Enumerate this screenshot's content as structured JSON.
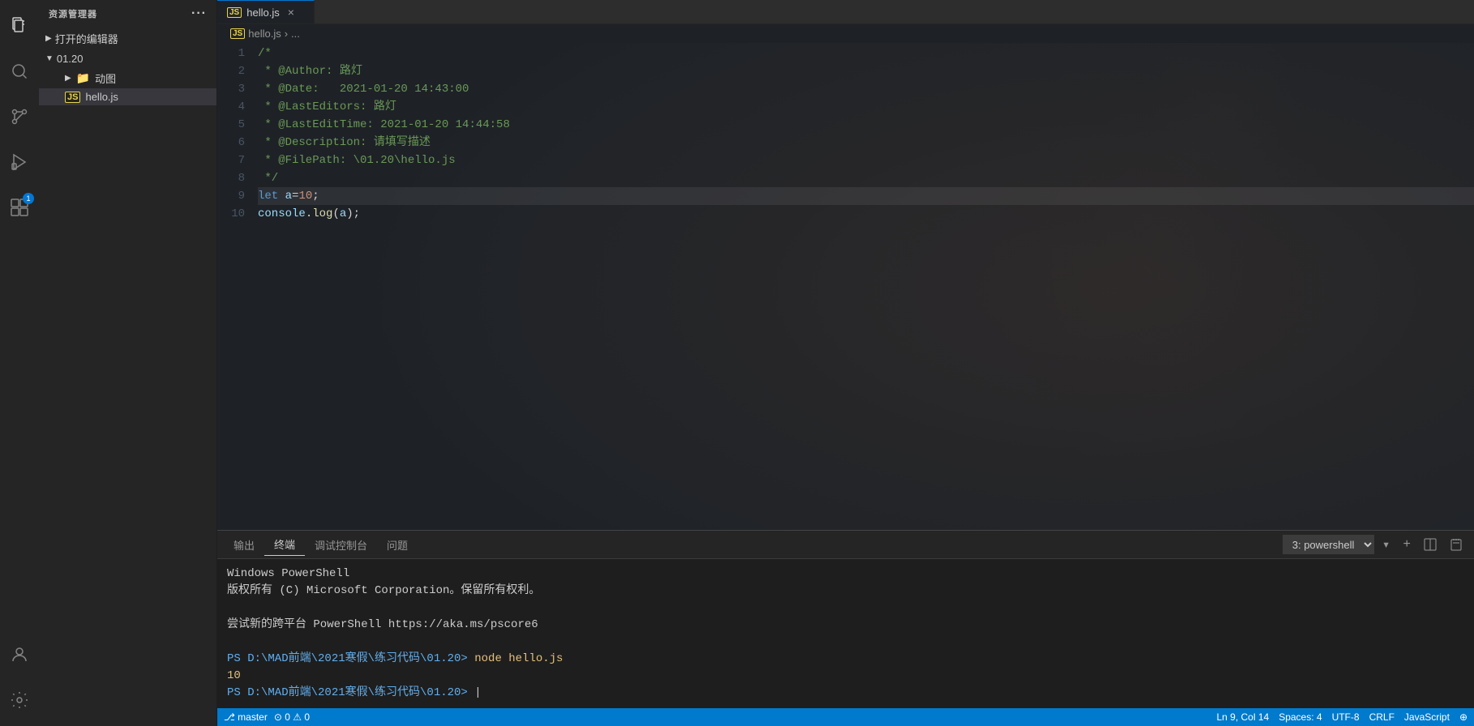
{
  "activityBar": {
    "icons": [
      {
        "name": "files-icon",
        "symbol": "⎘",
        "active": true,
        "badge": false
      },
      {
        "name": "search-icon",
        "symbol": "🔍",
        "active": false,
        "badge": false
      },
      {
        "name": "source-control-icon",
        "symbol": "⑂",
        "active": false,
        "badge": false
      },
      {
        "name": "run-icon",
        "symbol": "▷",
        "active": false,
        "badge": false
      },
      {
        "name": "extensions-icon",
        "symbol": "⊞",
        "active": false,
        "badge": true
      }
    ],
    "bottomIcons": [
      {
        "name": "account-icon",
        "symbol": "👤"
      },
      {
        "name": "settings-icon",
        "symbol": "⚙"
      }
    ]
  },
  "sidebar": {
    "header": "资源管理器",
    "moreOptionsLabel": "···",
    "sections": [
      {
        "label": "打开的编辑器",
        "expanded": false,
        "arrow": "▶"
      },
      {
        "label": "01.20",
        "expanded": true,
        "arrow": "▼",
        "children": [
          {
            "label": "动图",
            "type": "folder",
            "arrow": "▶"
          },
          {
            "label": "hello.js",
            "type": "file-js",
            "active": true
          }
        ]
      }
    ]
  },
  "editor": {
    "tab": {
      "filename": "hello.js",
      "prefix": "JS",
      "closeLabel": "×"
    },
    "breadcrumb": {
      "filename": "hello.js",
      "separator": "›",
      "extra": "..."
    },
    "lines": [
      {
        "num": 1,
        "content": "/*",
        "tokens": [
          {
            "text": "/*",
            "class": "c-comment"
          }
        ]
      },
      {
        "num": 2,
        "content": " * @Author: 路灯",
        "tokens": [
          {
            "text": " * @Author: 路灯",
            "class": "c-comment"
          }
        ]
      },
      {
        "num": 3,
        "content": " * @Date:   2021-01-20 14:43:00",
        "tokens": [
          {
            "text": " * @Date:   2021-01-20 14:43:00",
            "class": "c-comment"
          }
        ]
      },
      {
        "num": 4,
        "content": " * @LastEditors: 路灯",
        "tokens": [
          {
            "text": " * @LastEditors: 路灯",
            "class": "c-comment"
          }
        ]
      },
      {
        "num": 5,
        "content": " * @LastEditTime: 2021-01-20 14:44:58",
        "tokens": [
          {
            "text": " * @LastEditTime: 2021-01-20 14:44:58",
            "class": "c-comment"
          }
        ]
      },
      {
        "num": 6,
        "content": " * @Description: 请填写描述",
        "tokens": [
          {
            "text": " * @Description: 请填写描述",
            "class": "c-comment"
          }
        ]
      },
      {
        "num": 7,
        "content": " * @FilePath: \\01.20\\hello.js",
        "tokens": [
          {
            "text": " * @FilePath: \\01.20\\hello.js",
            "class": "c-comment"
          }
        ]
      },
      {
        "num": 8,
        "content": " */",
        "tokens": [
          {
            "text": " */",
            "class": "c-comment"
          }
        ]
      },
      {
        "num": 9,
        "content": "let a=10;",
        "highlighted": true,
        "tokens": [
          {
            "text": "let",
            "class": "c-let"
          },
          {
            "text": " ",
            "class": ""
          },
          {
            "text": "a",
            "class": "c-var"
          },
          {
            "text": "=",
            "class": "c-op"
          },
          {
            "text": "10",
            "class": "c-num"
          },
          {
            "text": ";",
            "class": "c-punct"
          }
        ]
      },
      {
        "num": 10,
        "content": "console.log(a);",
        "tokens": [
          {
            "text": "console",
            "class": "c-var"
          },
          {
            "text": ".",
            "class": "c-punct"
          },
          {
            "text": "log",
            "class": "c-func"
          },
          {
            "text": "(",
            "class": "c-punct"
          },
          {
            "text": "a",
            "class": "c-var"
          },
          {
            "text": ");",
            "class": "c-punct"
          }
        ]
      }
    ]
  },
  "terminal": {
    "tabs": [
      {
        "label": "输出",
        "active": false
      },
      {
        "label": "终端",
        "active": true
      },
      {
        "label": "调试控制台",
        "active": false
      },
      {
        "label": "问题",
        "active": false
      }
    ],
    "shellSelector": "3: powershell",
    "addLabel": "+",
    "splitLabel": "⧉",
    "killLabel": "🗑",
    "lines": [
      {
        "text": "Windows PowerShell",
        "class": "t-white"
      },
      {
        "text": "版权所有 (C) Microsoft Corporation。保留所有权利。",
        "class": "t-white"
      },
      {
        "text": "",
        "class": ""
      },
      {
        "text": "尝试新的跨平台 PowerShell https://aka.ms/pscore6",
        "class": "t-white"
      },
      {
        "text": "",
        "class": ""
      },
      {
        "text": "PS D:\\MAD前端\\2021寒假\\练习代码\\01.20> ",
        "class": "t-blue",
        "command": "node hello.js",
        "commandClass": "t-yellow"
      },
      {
        "text": "10",
        "class": "t-num"
      },
      {
        "text": "PS D:\\MAD前端\\2021寒假\\练习代码\\01.20> ",
        "class": "t-blue",
        "cursor": true
      }
    ]
  },
  "statusBar": {
    "left": [
      "master",
      "⊙ 0  ⚠ 0"
    ],
    "right": [
      "Ln 9, Col 14",
      "Spaces: 4",
      "UTF-8",
      "CRLF",
      "JavaScript",
      "⊕"
    ]
  }
}
